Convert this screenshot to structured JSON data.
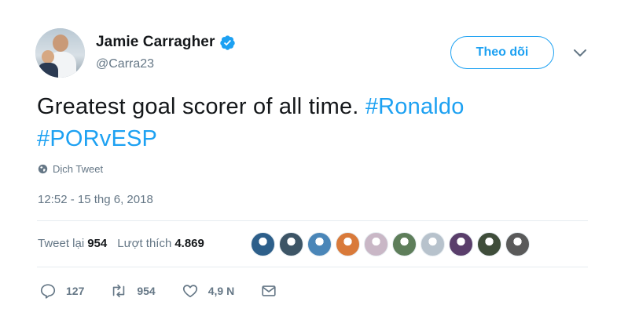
{
  "user": {
    "display_name": "Jamie Carragher",
    "handle": "@Carra23",
    "verified": true,
    "avatar_icon": "profile-photo"
  },
  "follow_button": {
    "label": "Theo dõi"
  },
  "tweet": {
    "text_plain": "Greatest goal scorer of all time.",
    "hashtag_1": "#Ronaldo",
    "hashtag_2": "#PORvESP"
  },
  "translate_link": {
    "label": "Dịch Tweet",
    "icon": "globe-icon"
  },
  "timestamp": "12:52 - 15 thg 6, 2018",
  "stats": {
    "retweets_label": "Tweet lại",
    "retweets_count": "954",
    "likes_label": "Lượt thích",
    "likes_count": "4.869"
  },
  "likers": [
    {
      "color": "#2d5f8a"
    },
    {
      "color": "#3d5566"
    },
    {
      "color": "#4a86b8"
    },
    {
      "color": "#d97a3a"
    },
    {
      "color": "#c9b7c6"
    },
    {
      "color": "#5e7e5a"
    },
    {
      "color": "#b7c2cc"
    },
    {
      "color": "#5a3e6b"
    },
    {
      "color": "#3f4d3a"
    },
    {
      "color": "#5a5a5a"
    }
  ],
  "actions": {
    "reply_count": "127",
    "retweet_count": "954",
    "like_count": "4,9 N"
  },
  "colors": {
    "accent": "#1da1f2",
    "text": "#14171a",
    "secondary": "#657786",
    "divider": "#e6ecf0"
  }
}
